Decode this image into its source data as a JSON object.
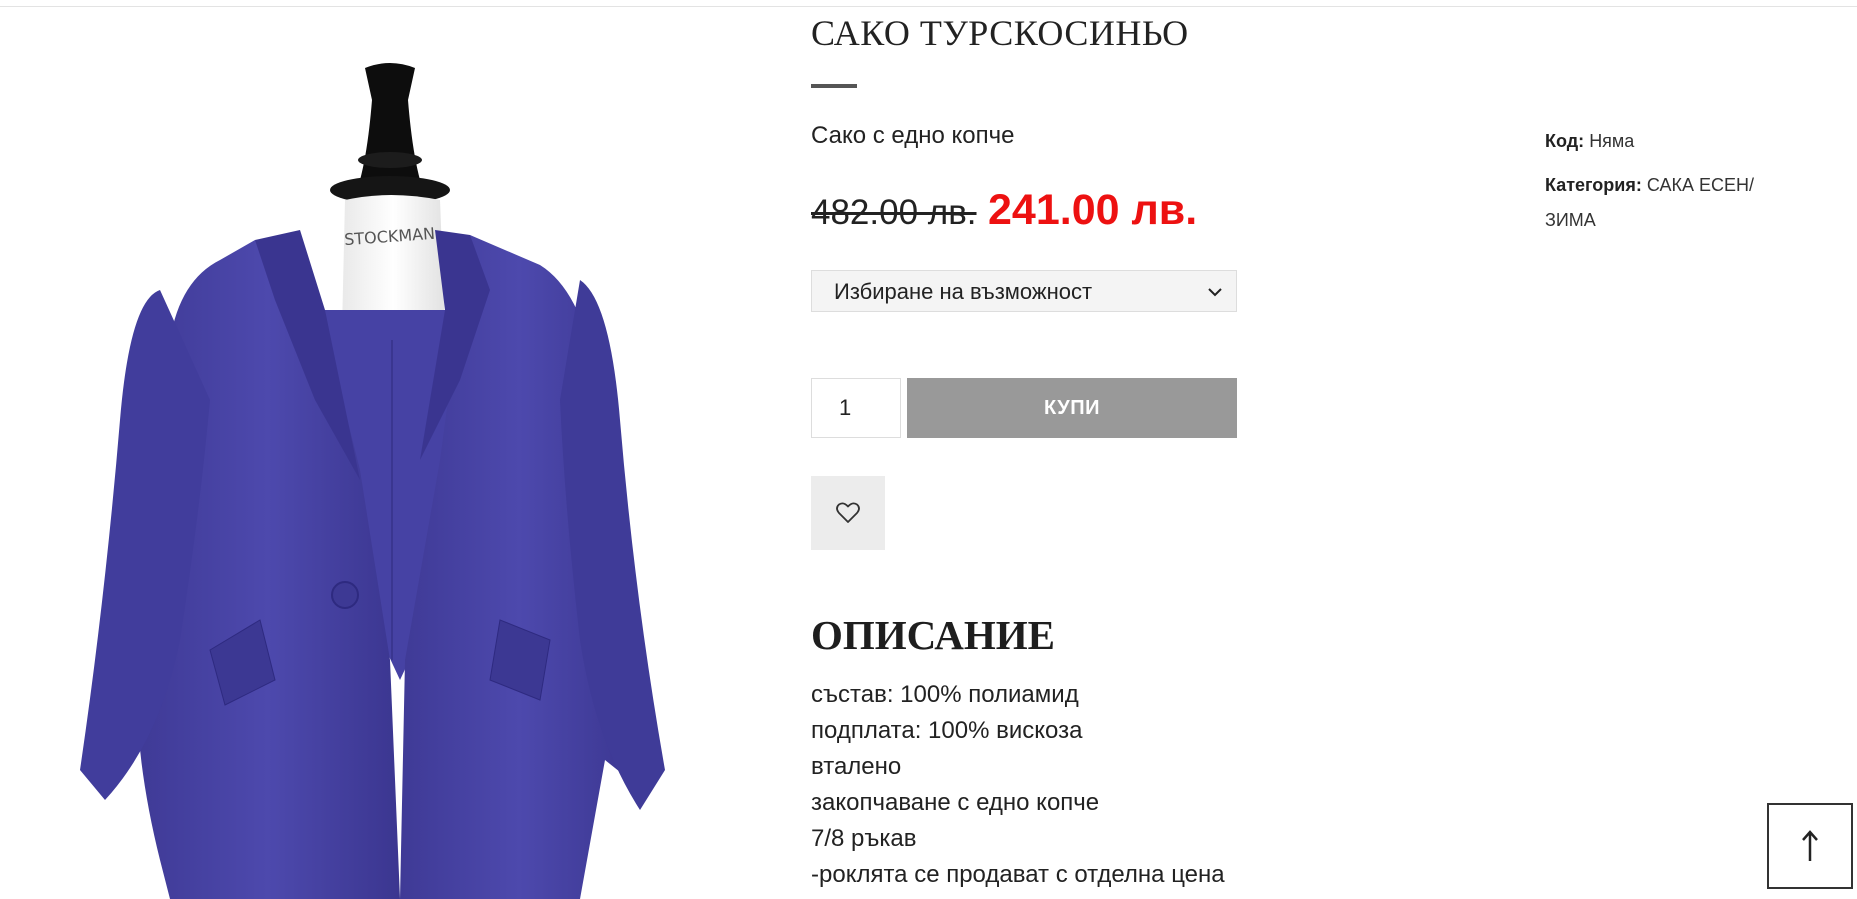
{
  "product": {
    "title": "САКО ТУРСКОСИНЬО",
    "subtitle": "Сако с едно копче",
    "price_old": "482.00 лв.",
    "price_new": "241.00 лв.",
    "variant_placeholder": "Избиране на възможност",
    "quantity": "1",
    "buy_label": "КУПИ"
  },
  "description": {
    "heading": "ОПИСАНИЕ",
    "lines": [
      "състав:  100% полиамид",
      "подплата: 100% вискоза",
      "вталено",
      "закопчаване с едно копче",
      "7/8 ръкав",
      "-роклята се продават с отделна цена"
    ]
  },
  "meta": {
    "code_label": "Код:",
    "code_value": "Няма",
    "category_label": "Категория:",
    "category_value": "САКА ЕСЕН/ ЗИМА"
  },
  "image": {
    "mannequin_brand": "STOCKMAN"
  },
  "icons": {
    "wishlist": "heart-icon",
    "select": "chevron-down-icon",
    "scroll_top": "arrow-up-icon"
  },
  "colors": {
    "price_sale": "#ed1111",
    "buy_button": "#999999",
    "jacket": "#4a46a6"
  }
}
